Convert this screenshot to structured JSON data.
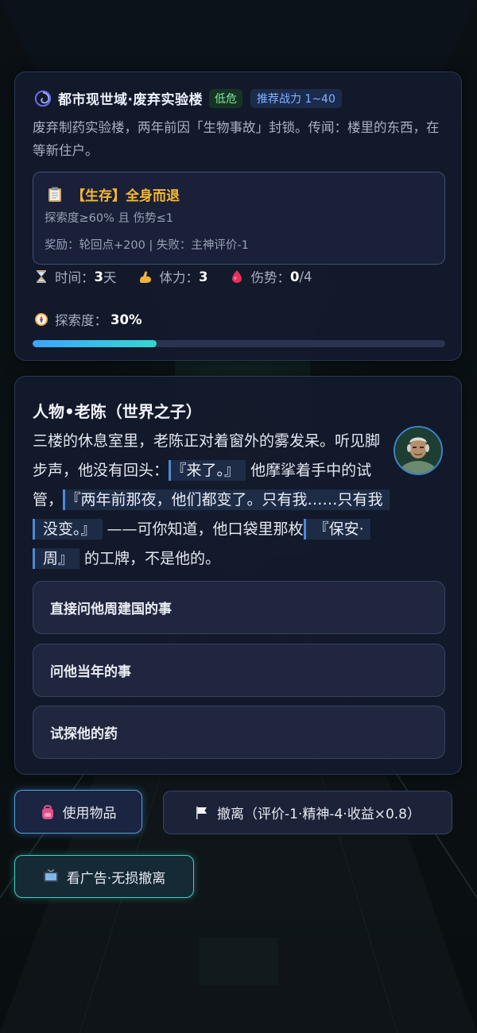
{
  "world": {
    "title": "都市现世域·废弃实验楼",
    "danger_badge": "低危",
    "power_badge": "推荐战力 1~40",
    "description": "废弃制药实验楼，两年前因「生物事故」封锁。传闻：楼里的东西，在等新住户。"
  },
  "quest": {
    "title": "【生存】全身而退",
    "condition": "探索度≥60% 且 伤势≤1",
    "reward": "奖励：轮回点+200 | 失败：主神评价-1"
  },
  "stats": {
    "time_label": "时间：",
    "time_value": "3",
    "time_unit": "天",
    "stamina_label": "体力：",
    "stamina_value": "3",
    "injury_label": "伤势：",
    "injury_value": "0",
    "injury_max": "/4",
    "explore_label": "探索度：",
    "explore_value": "30%",
    "explore_progress": 0.3
  },
  "npc": {
    "title": "人物•老陈（世界之子）",
    "story_part1": "三楼的休息室里，老陈正对着窗外的雾发呆。听见脚步声，他没有回头：",
    "quote1": "『来了。』",
    "story_part2": " 他摩挲着手中的试管，",
    "quote2": "『两年前那夜，他们都变了。只有我……只有我没变。』",
    "story_part3": " ——可你知道，他口袋里那枚",
    "quote3": "『保安·周』",
    "story_part4": " 的工牌，不是他的。"
  },
  "choices": [
    "直接问他周建国的事",
    "问他当年的事",
    "试探他的药"
  ],
  "actions": {
    "use_item": "使用物品",
    "retreat": "撤离（评价-1·精神-4·收益×0.8）",
    "ad_retreat": "看广告·无损撤离"
  },
  "icons": {
    "world": "swirl-icon",
    "quest": "clipboard-icon",
    "time": "hourglass-icon",
    "stamina": "flexed-arm-icon",
    "injury": "blood-drop-icon",
    "explore": "compass-icon",
    "use_item": "backpack-icon",
    "retreat": "flag-icon",
    "ad_retreat": "tv-icon"
  },
  "colors": {
    "quest_title": "#f5b932",
    "danger_badge": "#7fe7a0",
    "power_badge": "#7fb4ff",
    "progress_start": "#3fa4ff",
    "progress_end": "#34d6d0"
  }
}
